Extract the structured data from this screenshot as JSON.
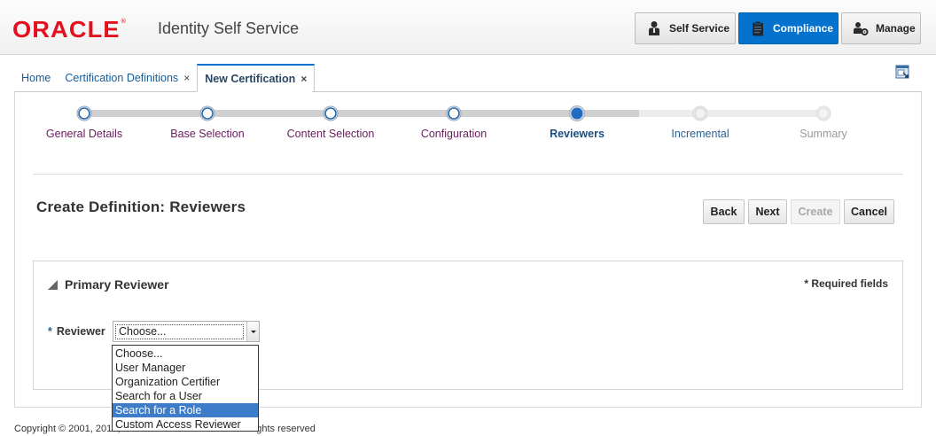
{
  "header": {
    "logo_text": "ORACLE",
    "logo_reg": "®",
    "product_name": "Identity Self Service",
    "nav_buttons": [
      {
        "label": "Self Service",
        "icon": "person-icon"
      },
      {
        "label": "Compliance",
        "icon": "clipboard-icon",
        "active": true
      },
      {
        "label": "Manage",
        "icon": "manage-users-icon"
      }
    ],
    "active_color": "#0572ce"
  },
  "tabs": [
    {
      "label": "Home",
      "closable": false
    },
    {
      "label": "Certification Definitions",
      "closable": true,
      "close_glyph": "×"
    },
    {
      "label": "New Certification",
      "closable": true,
      "active": true,
      "close_glyph": "×"
    }
  ],
  "train": {
    "stops": [
      {
        "label": "General Details",
        "state": "visited"
      },
      {
        "label": "Base Selection",
        "state": "visited"
      },
      {
        "label": "Content Selection",
        "state": "visited"
      },
      {
        "label": "Configuration",
        "state": "visited"
      },
      {
        "label": "Reviewers",
        "state": "current"
      },
      {
        "label": "Incremental",
        "state": "unvisited"
      },
      {
        "label": "Summary",
        "state": "disabled"
      }
    ]
  },
  "page": {
    "title": "Create Definition: Reviewers",
    "buttons": {
      "back": "Back",
      "next": "Next",
      "create": "Create",
      "cancel": "Cancel"
    }
  },
  "section": {
    "title": "Primary Reviewer",
    "required_note": "* Required fields",
    "reviewer_label": "Reviewer",
    "required_star": "*",
    "reviewer_value": "Choose...",
    "options": [
      "Choose...",
      "User Manager",
      "Organization Certifier",
      "Search for a User",
      "Search for a Role",
      "Custom Access Reviewer"
    ],
    "highlighted_option": "Search for a Role"
  },
  "footer": {
    "copyright": "Copyright © 2001, 2017, Oracle and/or its affiliates. All rights reserved"
  }
}
